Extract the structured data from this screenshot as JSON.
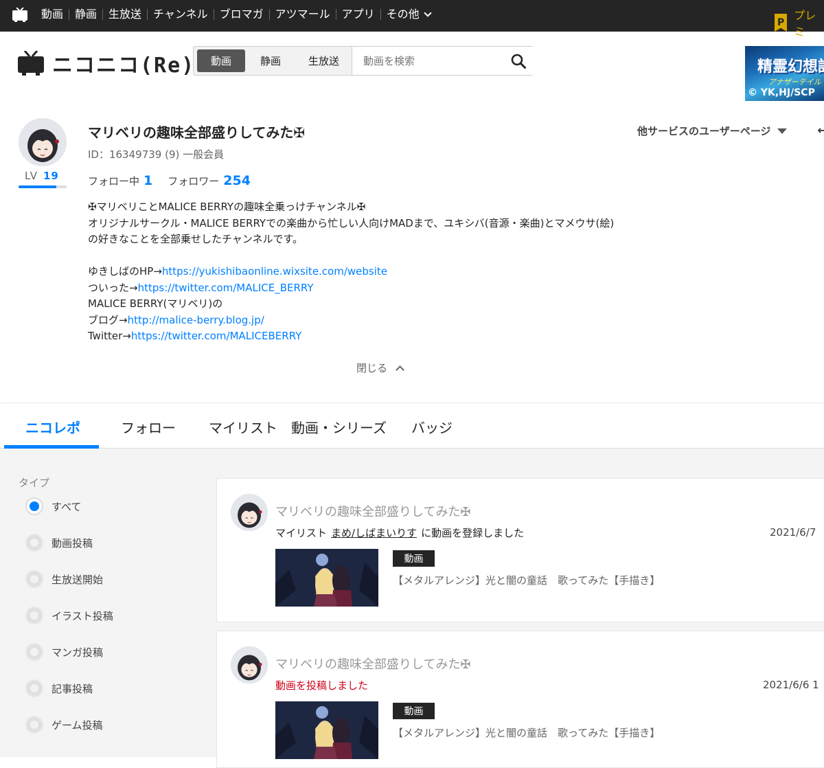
{
  "topbar": {
    "nav": [
      "動画",
      "静画",
      "生放送",
      "チャンネル",
      "ブロマガ",
      "アツマール",
      "アプリ",
      "その他"
    ],
    "premium_badge": "P",
    "premium_label": "プレミ"
  },
  "header": {
    "logo_text": "ニコニコ(Re)",
    "search_tabs": [
      "動画",
      "静画",
      "生放送"
    ],
    "search_placeholder": "動画を検索",
    "ad": {
      "title": "精霊幻想記",
      "subtitle": "アナザーテイル",
      "copyright": "© YK,HJ/SCP"
    }
  },
  "profile": {
    "name": "マリベリの趣味全部盛りしてみた✠",
    "id_line": "ID：16349739 (9) 一般会員",
    "level_label": "LV",
    "level": "19",
    "level_progress": 0.78,
    "following_label": "フォロー中",
    "following": "1",
    "followers_label": "フォロワー",
    "followers": "254",
    "other_services": "他サービスのユーザーページ",
    "description": {
      "line1": "✠マリベリことMALICE BERRYの趣味全乗っけチャンネル✠",
      "line2": "オリジナルサークル・MALICE BERRYでの楽曲から忙しい人向けMADまで、ユキシバ(音源・楽曲)とマメウサ(絵)",
      "line3": "の好きなことを全部乗せしたチャンネルです。",
      "hp_label": "ゆきしばのHP→",
      "hp_url": "https://yukishibaonline.wixsite.com/website",
      "tw1_label": "ついった→",
      "tw1_url": "https://twitter.com/MALICE_BERRY",
      "mb_line": "MALICE BERRY(マリベリ)の",
      "blog_label": "ブログ→",
      "blog_url": "http://malice-berry.blog.jp/",
      "tw2_label": "Twitter→",
      "tw2_url": "https://twitter.com/MALICEBERRY"
    },
    "close_label": "閉じる"
  },
  "tabs": [
    "ニコレポ",
    "フォロー",
    "マイリスト",
    "動画・シリーズ",
    "バッジ"
  ],
  "filter": {
    "label": "タイプ",
    "options": [
      "すべて",
      "動画投稿",
      "生放送開始",
      "イラスト投稿",
      "マンガ投稿",
      "記事投稿",
      "ゲーム投稿"
    ],
    "selected": "すべて"
  },
  "feed": [
    {
      "user": "マリベリの趣味全部盛りしてみた✠",
      "action_prefix": "マイリスト",
      "action_link": "まめ/しばまいりす",
      "action_suffix": "に動画を登録しました",
      "date": "2021/6/7",
      "badge": "動画",
      "title": "【メタルアレンジ】光と闇の童話　歌ってみた【手描き】"
    },
    {
      "user": "マリベリの趣味全部盛りしてみた✠",
      "action": "動画を投稿しました",
      "date": "2021/6/6 1",
      "badge": "動画",
      "title": "【メタルアレンジ】光と闇の童話　歌ってみた【手描き】"
    }
  ]
}
